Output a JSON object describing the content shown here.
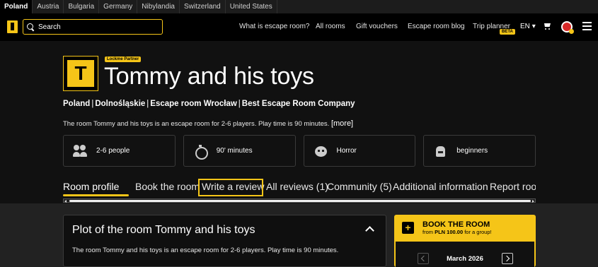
{
  "countries": [
    "Poland",
    "Austria",
    "Bulgaria",
    "Germany",
    "Nibylandia",
    "Switzerland",
    "United States"
  ],
  "active_country": "Poland",
  "header": {
    "search_placeholder": "Search",
    "nav": [
      "What is escape room?",
      "All rooms",
      "Gift vouchers",
      "Escape room blog",
      "Trip planner"
    ],
    "beta_label": "BETA",
    "language": "EN"
  },
  "room": {
    "logo_letter": "T",
    "partner_badge": "Lockme Partner",
    "title": "Tommy and his toys",
    "breadcrumb": [
      "Poland",
      "Dolnośląskie",
      "Escape room Wrocław",
      "Best Escape Room Company"
    ],
    "description": "The room Tommy and his toys is an escape room for 2-6 players. Play time is 90 minutes.",
    "more_label": "[more]",
    "features": [
      {
        "icon": "people-icon",
        "label": "2-6 people"
      },
      {
        "icon": "timer-icon",
        "label": "90' minutes"
      },
      {
        "icon": "horror-icon",
        "label": "Horror"
      },
      {
        "icon": "level-icon",
        "label": "beginners"
      }
    ]
  },
  "tabs": [
    "Room profile",
    "Book the room",
    "Write a review",
    "All reviews (1)",
    "Community (5)",
    "Additional information",
    "Report room"
  ],
  "active_tab": "Room profile",
  "plot": {
    "title": "Plot of the room Tommy and his toys",
    "text": "The room Tommy and his toys is an escape room for 2-6 players. Play time is 90 minutes."
  },
  "booking": {
    "title": "BOOK THE ROOM",
    "subtitle_prefix": "from",
    "price": "PLN 100.00",
    "subtitle_suffix": "for a group!",
    "month": "March 2026"
  },
  "colors": {
    "accent": "#f5c518",
    "background": "#111111",
    "section": "#222222"
  }
}
